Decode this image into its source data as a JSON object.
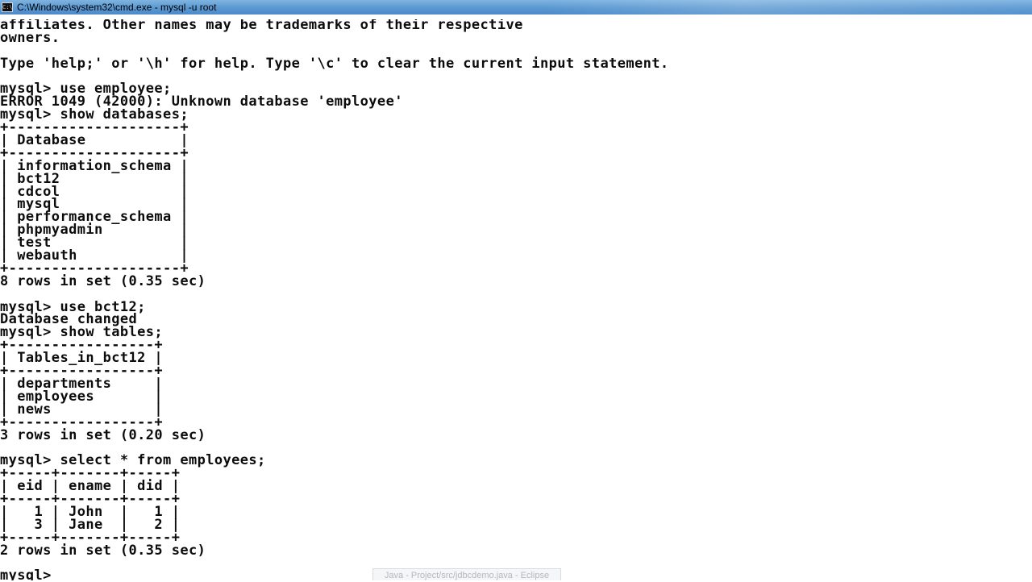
{
  "window": {
    "title": "C:\\Windows\\system32\\cmd.exe - mysql  -u root",
    "icon": "cmd-icon",
    "icon_glyph": "C:\\"
  },
  "console": {
    "lines": [
      "affiliates. Other names may be trademarks of their respective",
      "owners.",
      "",
      "Type 'help;' or '\\h' for help. Type '\\c' to clear the current input statement.",
      "",
      "mysql> use employee;",
      "ERROR 1049 (42000): Unknown database 'employee'",
      "mysql> show databases;",
      "+--------------------+",
      "| Database           |",
      "+--------------------+",
      "| information_schema |",
      "| bct12              |",
      "| cdcol              |",
      "| mysql              |",
      "| performance_schema |",
      "| phpmyadmin         |",
      "| test               |",
      "| webauth            |",
      "+--------------------+",
      "8 rows in set (0.35 sec)",
      "",
      "mysql> use bct12;",
      "Database changed",
      "mysql> show tables;",
      "+-----------------+",
      "| Tables_in_bct12 |",
      "+-----------------+",
      "| departments     |",
      "| employees       |",
      "| news            |",
      "+-----------------+",
      "3 rows in set (0.20 sec)",
      "",
      "mysql> select * from employees;",
      "+-----+-------+-----+",
      "| eid | ename | did |",
      "+-----+-------+-----+",
      "|   1 | John  |   1 |",
      "|   3 | Jane  |   2 |",
      "+-----+-------+-----+",
      "2 rows in set (0.35 sec)",
      "",
      "mysql> "
    ]
  },
  "taskbar": {
    "hint_label": "Java - Project/src/jdbcdemo.java - Eclipse"
  }
}
